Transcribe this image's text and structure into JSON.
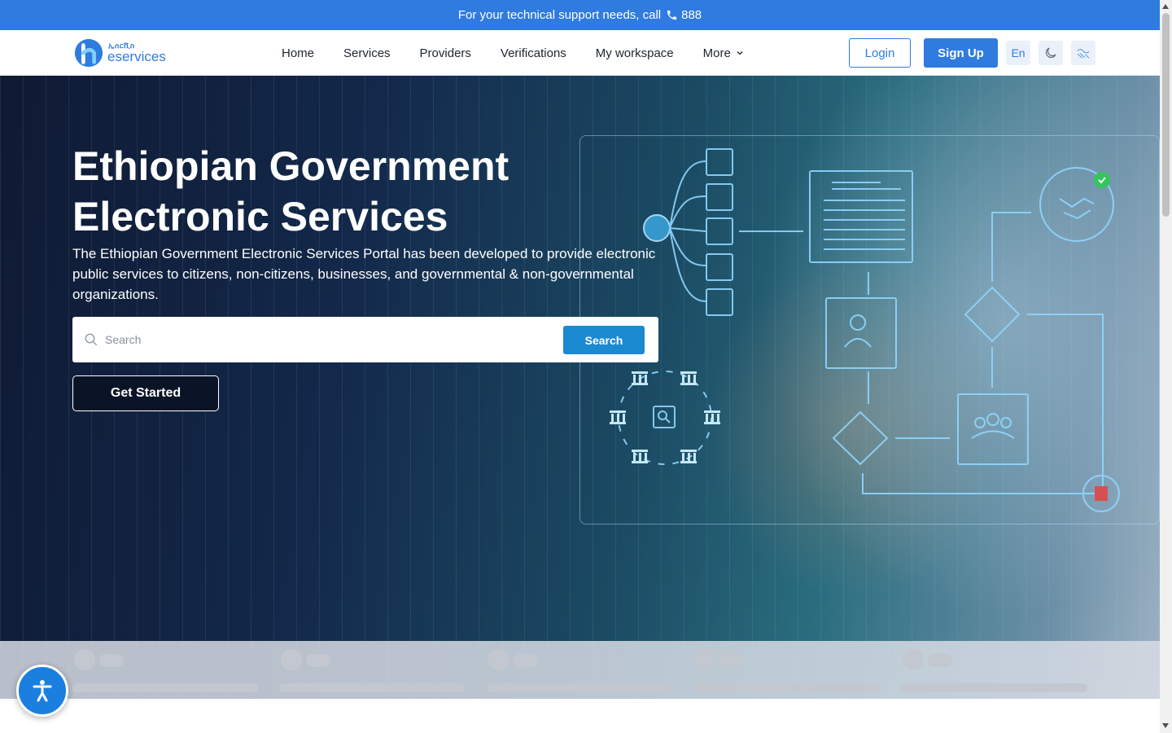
{
  "support": {
    "text": "For your technical support needs, call",
    "phone": "888"
  },
  "logo": {
    "small": "ኢሰርቪስ",
    "big": "eservices"
  },
  "nav": {
    "home": "Home",
    "services": "Services",
    "providers": "Providers",
    "verifications": "Verifications",
    "workspace": "My workspace",
    "more": "More"
  },
  "actions": {
    "login": "Login",
    "signup": "Sign Up",
    "lang": "En"
  },
  "hero": {
    "title": "Ethiopian Government Electronic Services",
    "description": "The Ethiopian Government Electronic Services Portal has been developed to provide electronic public services to citizens, non-citizens, businesses, and governmental & non-governmental organizations.",
    "search_placeholder": "Search",
    "search_button": "Search",
    "get_started": "Get Started"
  },
  "colors": {
    "primary": "#2f7be0",
    "search_button": "#1c8ad0",
    "hero_dark": "#0f1a33"
  },
  "icons": [
    "phone-icon",
    "chevron-down-icon",
    "moon-icon",
    "accessibility-settings-icon",
    "search-icon",
    "accessibility-icon"
  ]
}
